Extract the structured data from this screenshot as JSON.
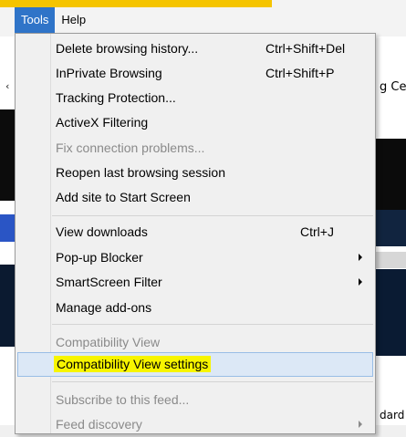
{
  "menubar": {
    "tools": "Tools",
    "help": "Help"
  },
  "background": {
    "peek_text": "g Cer",
    "bottom_text": "dard"
  },
  "menu": {
    "items": [
      {
        "label": "Delete browsing history...",
        "shortcut": "Ctrl+Shift+Del"
      },
      {
        "label": "InPrivate Browsing",
        "shortcut": "Ctrl+Shift+P"
      },
      {
        "label": "Tracking Protection...",
        "shortcut": ""
      },
      {
        "label": "ActiveX Filtering",
        "shortcut": ""
      },
      {
        "label": "Fix connection problems...",
        "shortcut": "",
        "disabled": true
      },
      {
        "label": "Reopen last browsing session",
        "shortcut": ""
      },
      {
        "label": "Add site to Start Screen",
        "shortcut": ""
      },
      {
        "label": "View downloads",
        "shortcut": "Ctrl+J"
      },
      {
        "label": "Pop-up Blocker",
        "shortcut": "",
        "submenu": true
      },
      {
        "label": "SmartScreen Filter",
        "shortcut": "",
        "submenu": true
      },
      {
        "label": "Manage add-ons",
        "shortcut": ""
      },
      {
        "label": "Compatibility View",
        "shortcut": "",
        "disabled": true
      },
      {
        "label": "Compatibility View settings",
        "shortcut": "",
        "selected": true,
        "highlight_color": "#f7f500"
      },
      {
        "label": "Subscribe to this feed...",
        "shortcut": "",
        "disabled": true
      },
      {
        "label": "Feed discovery",
        "shortcut": "",
        "disabled": true,
        "submenu": true
      }
    ]
  },
  "colors": {
    "menu_active_bg": "#2f74c8",
    "selection_bg": "#dce8f6",
    "highlighter": "#f7f500"
  }
}
